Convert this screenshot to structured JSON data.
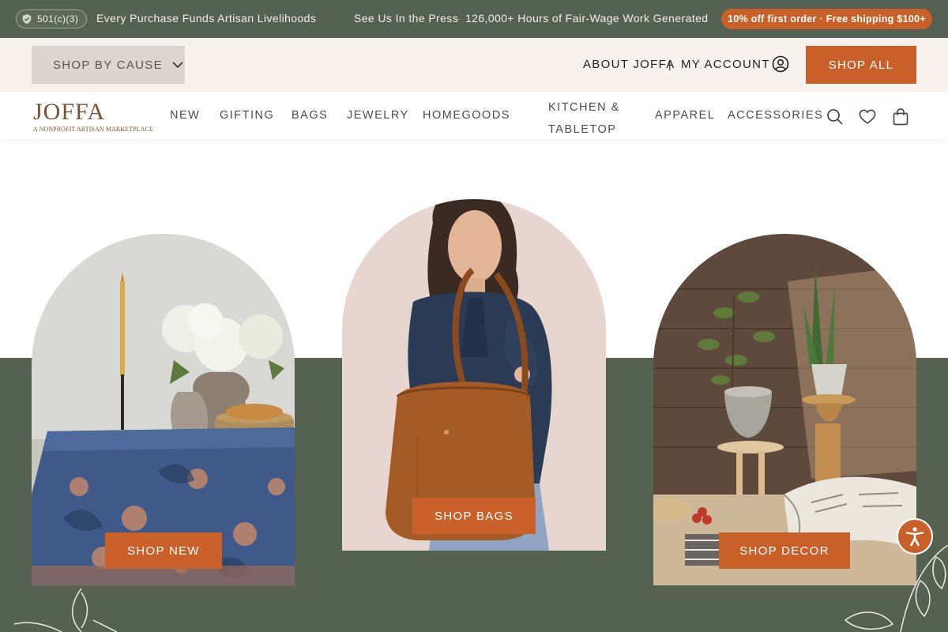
{
  "topbar": {
    "badge": "501(c)(3)",
    "mission": "Every Purchase Funds Artisan Livelihoods",
    "press": "See Us In the Press",
    "separator": "·",
    "hours": "126,000+ Hours of Fair-Wage Work Generated",
    "promo": "10% off first order · Free shipping $100+"
  },
  "utility": {
    "shop_by_cause": "SHOP BY CAUSE",
    "about": "ABOUT JOFFA",
    "divider": "|",
    "account": "MY ACCOUNT",
    "shop_all": "SHOP ALL"
  },
  "logo": {
    "name": "JOFFA",
    "tagline": "A NONPROFIT ARTISAN MARKETPLACE"
  },
  "nav": {
    "items": [
      "NEW",
      "GIFTING",
      "BAGS",
      "JEWELRY",
      "HOMEGOODS",
      "KITCHEN & TABLETOP",
      "APPAREL",
      "ACCESSORIES"
    ]
  },
  "icons": {
    "badge": "shield-check-icon",
    "cause_dropdown": "chevron-down-icon",
    "account": "user-circle-icon",
    "search": "search-icon",
    "wishlist": "heart-icon",
    "cart": "shopping-bag-icon",
    "accessibility": "accessibility-icon"
  },
  "hero": {
    "cards": [
      {
        "cta": "SHOP NEW"
      },
      {
        "cta": "SHOP BAGS"
      },
      {
        "cta": "SHOP DECOR"
      }
    ]
  },
  "colors": {
    "topbar_bg": "#556152",
    "accent": "#c9602a",
    "band_bg": "#566251",
    "utility_bg": "#f7f2ee"
  }
}
